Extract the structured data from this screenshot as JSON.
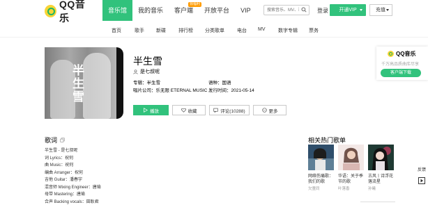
{
  "header": {
    "logo_text": "QQ音乐",
    "nav": [
      "音乐馆",
      "我的音乐",
      "客户端",
      "开放平台",
      "VIP"
    ],
    "nav_badge": "领福利",
    "search_placeholder": "搜索音乐、MV、歌",
    "login": "登录",
    "vip_button": "开通VIP",
    "charge_button": "充值"
  },
  "subnav": [
    "首页",
    "歌手",
    "新碟",
    "排行榜",
    "分类歌单",
    "电台",
    "MV",
    "数字专辑",
    "票务"
  ],
  "song": {
    "title": "半生雪",
    "singer": "是七叔呢",
    "album_label": "专辑：",
    "album": "半生雪",
    "language_label": "语种：",
    "language": "国语",
    "company_label": "唱片公司：",
    "company": "乐无限 ETERNAL MUSIC",
    "release_label": "发行时间：",
    "release": "2021-05-14",
    "cover_title": "半生雪"
  },
  "actions": {
    "play": "播放",
    "fav": "收藏",
    "comment": "评论(10288)",
    "more": "更多"
  },
  "lyrics": {
    "heading": "歌词",
    "lines": [
      "半生雪 - 是七叔呢",
      "词 Lyrics：祝何",
      "曲 Music：祝何",
      "编曲 Arranger：祝何",
      "吉他 Guitar：潘春宇",
      "混音师 Mixing Engineer：唐瑜",
      "母带 Mastering：唐瑜",
      "合声 Backing vocals：田耿君"
    ]
  },
  "promo": {
    "logo_text": "QQ音乐",
    "subtitle": "千万高品质曲库尽享",
    "button": "客户端下载"
  },
  "related": {
    "heading": "相关热门歌单",
    "cards": [
      {
        "name": "网络伤痛歌：我们的歌",
        "plays": "欠童同"
      },
      {
        "name": "华语：关于季节的歌",
        "plays": "叶落香"
      },
      {
        "name": "古风丨诗浮花落流星",
        "plays": "孙曦"
      }
    ]
  },
  "side_tools": {
    "feedback": "反馈"
  },
  "colors": {
    "accent": "#31c27c",
    "logo_yellow": "#f8d436",
    "badge": "#ff9b00"
  }
}
